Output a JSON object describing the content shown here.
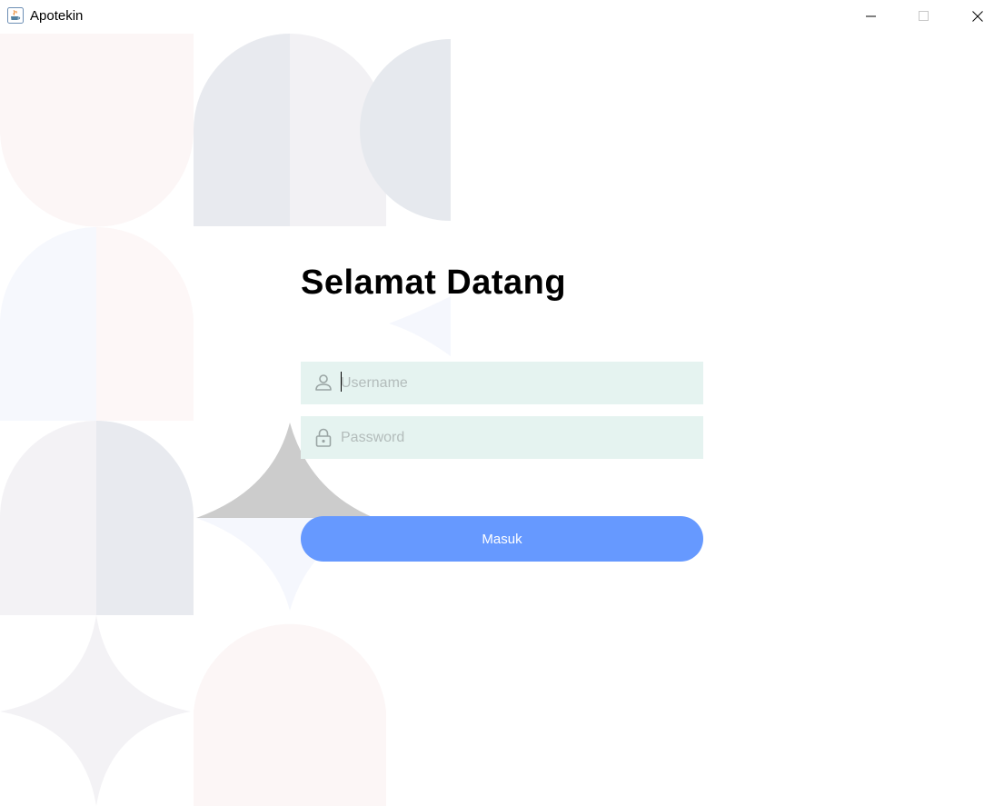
{
  "window": {
    "title": "Apotekin",
    "icons": {
      "app": "java-coffee-icon",
      "minimize": "minimize-icon",
      "maximize": "maximize-icon",
      "close": "close-icon"
    }
  },
  "login": {
    "heading": "Selamat Datang",
    "username": {
      "placeholder": "Username",
      "value": "",
      "icon": "user-icon"
    },
    "password": {
      "placeholder": "Password",
      "value": "",
      "icon": "lock-icon"
    },
    "submit_label": "Masuk"
  },
  "colors": {
    "field_background": "#e5f3f0",
    "button_background": "#6699ff",
    "button_text": "#ffffff",
    "placeholder": "#b3bcbb"
  }
}
